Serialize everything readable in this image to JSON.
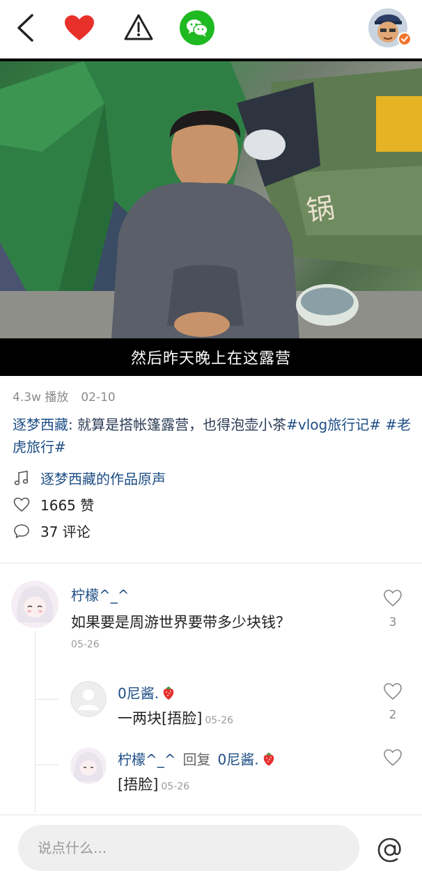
{
  "video": {
    "subtitle": "然后昨天晚上在这露营"
  },
  "meta": {
    "plays": "4.3w 播放",
    "date": "02-10"
  },
  "caption": {
    "author": "逐梦西藏",
    "separator": ": ",
    "text": "就算是搭帐篷露营，也得泡壶小茶",
    "tags": [
      "#vlog旅行记#",
      "#老虎旅行#"
    ]
  },
  "music": "逐梦西藏的作品原声",
  "likes": "1665 赞",
  "comments_count": "37 评论",
  "comments": [
    {
      "name": "柠檬^_^",
      "text": "如果要是周游世界要带多少块钱？",
      "date": "05-26",
      "likes": "3"
    }
  ],
  "replies": [
    {
      "name": "0尼酱.",
      "text": "一两块[捂脸]",
      "date": "05-26",
      "likes": "2"
    },
    {
      "name": "柠檬^_^",
      "reply_word": "回复",
      "reply_to": "0尼酱.",
      "text": "[捂脸]",
      "date": "05-26"
    }
  ],
  "input": {
    "placeholder": "说点什么..."
  },
  "colors": {
    "heart": "#e8302a",
    "wechat": "#1fb922",
    "link": "#1d4d86"
  }
}
